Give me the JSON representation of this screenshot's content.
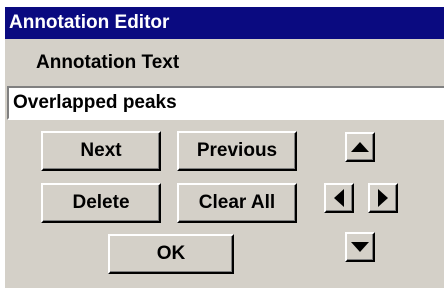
{
  "window": {
    "title": "Annotation Editor"
  },
  "form": {
    "label": "Annotation Text",
    "text_value": "Overlapped peaks"
  },
  "buttons": {
    "next": "Next",
    "previous": "Previous",
    "delete": "Delete",
    "clear_all": "Clear All",
    "ok": "OK"
  },
  "arrows": [
    "up-arrow-icon",
    "left-arrow-icon",
    "right-arrow-icon",
    "down-arrow-icon"
  ]
}
